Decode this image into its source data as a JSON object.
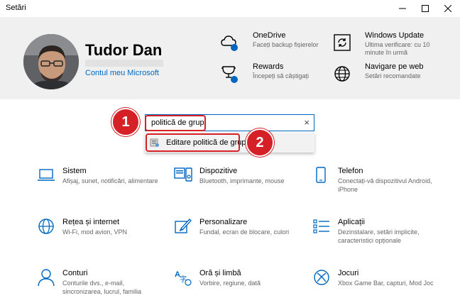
{
  "window": {
    "title": "Setări"
  },
  "profile": {
    "name": "Tudor Dan",
    "account_link": "Contul meu Microsoft"
  },
  "header_items": [
    {
      "title": "OneDrive",
      "subtitle": "Faceți backup fișierelor"
    },
    {
      "title": "Windows Update",
      "subtitle": "Ultima verificare: cu 10 minute în urmă"
    },
    {
      "title": "Rewards",
      "subtitle": "Începeți să câștigați"
    },
    {
      "title": "Navigare pe web",
      "subtitle": "Setări recomandate"
    }
  ],
  "search": {
    "value": "politică de grup",
    "clear_icon": "×"
  },
  "suggestion": {
    "label": "Editare politică de grup"
  },
  "callouts": [
    "1",
    "2"
  ],
  "tiles": [
    {
      "title": "Sistem",
      "subtitle": "Afișaj, sunet, notificări, alimentare",
      "icon": "laptop-icon"
    },
    {
      "title": "Dispozitive",
      "subtitle": "Bluetooth, imprimante, mouse",
      "icon": "devices-icon"
    },
    {
      "title": "Telefon",
      "subtitle": "Conectați-vă dispozitivul Android, iPhone",
      "icon": "phone-icon"
    },
    {
      "title": "Rețea și internet",
      "subtitle": "Wi-Fi, mod avion, VPN",
      "icon": "globe-icon"
    },
    {
      "title": "Personalizare",
      "subtitle": "Fundal, ecran de blocare, culori",
      "icon": "brush-icon"
    },
    {
      "title": "Aplicații",
      "subtitle": "Dezinstalare, setări implicite, caracteristici opționale",
      "icon": "apps-list-icon"
    },
    {
      "title": "Conturi",
      "subtitle": "Conturile dvs., e-mail, sincronizarea, lucrul, familia",
      "icon": "person-icon"
    },
    {
      "title": "Oră și limbă",
      "subtitle": "Vorbire, regiune, dată",
      "icon": "time-language-icon"
    },
    {
      "title": "Jocuri",
      "subtitle": "Xbox Game Bar, capturi, Mod Joc",
      "icon": "xbox-icon"
    }
  ],
  "colors": {
    "accent": "#0067c0",
    "highlight": "#d62027",
    "header_bg": "#f0f0f0"
  }
}
